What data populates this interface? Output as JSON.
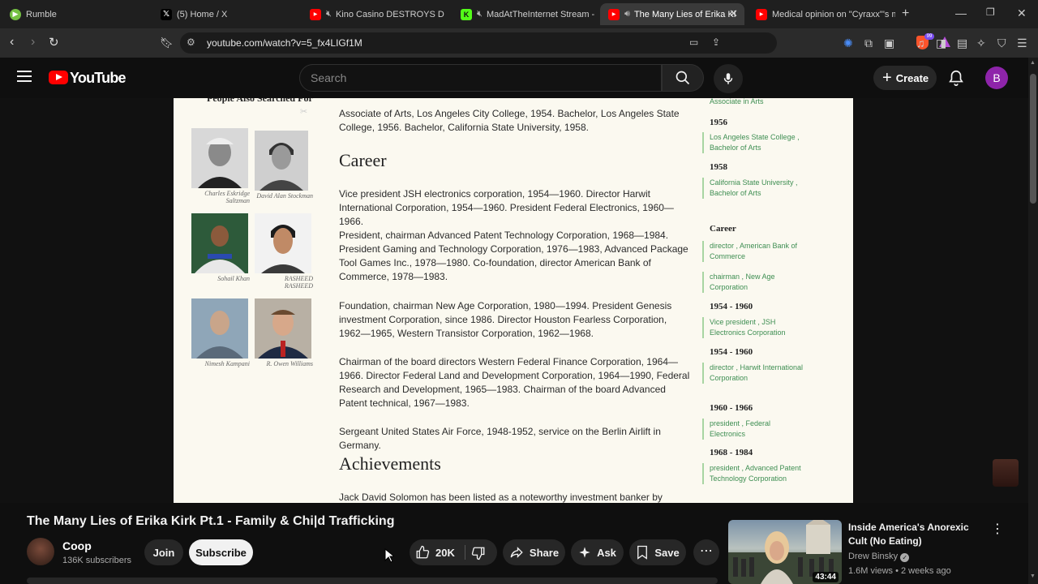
{
  "browser": {
    "tabs": [
      {
        "label": "Rumble",
        "favicon_color": "#74c043",
        "favicon": "▶",
        "muted": false,
        "active": false
      },
      {
        "label": "(5) Home / X",
        "favicon_color": "#000000",
        "favicon": "X",
        "muted": false,
        "active": false
      },
      {
        "label": "Kino Casino DESTROYS DSP",
        "favicon_color": "#ff0000",
        "favicon": "▶",
        "muted": true,
        "active": false
      },
      {
        "label": "MadAtTheInternet Stream -",
        "favicon_color": "#53fc18",
        "favicon": "K",
        "muted": true,
        "active": false
      },
      {
        "label": "The Many Lies of Erika Ki",
        "favicon_color": "#ff0000",
        "favicon": "▶",
        "muted": false,
        "audio": true,
        "active": true
      },
      {
        "label": "Medical opinion on \"Cyraxx\"'s m",
        "favicon_color": "#ff0000",
        "favicon": "▶",
        "muted": false,
        "active": false
      }
    ],
    "url": "youtube.com/watch?v=5_fx4LIGf1M"
  },
  "youtube": {
    "logo_text": "YouTube",
    "search_placeholder": "Search",
    "create_label": "Create",
    "avatar_letter": "B"
  },
  "video_frame": {
    "sidebar_title": "People Also Searched For",
    "people": [
      {
        "name": "Charles Eskridge Saltzman"
      },
      {
        "name": "David Alan Stockman"
      },
      {
        "name": "Sohail Khan"
      },
      {
        "name": "RASHEED RASHEED"
      },
      {
        "name": "Nimesh Kampani"
      },
      {
        "name": "R. Owen Williams"
      }
    ],
    "education_text": "Associate of Arts, Los Angeles City College, 1954. Bachelor, Los Angeles State College, 1956. Bachelor, California State University, 1958.",
    "career_heading": "Career",
    "career_paragraphs": [
      "Vice president JSH electronics corporation, 1954—1960. Director Harwit International Corporation, 1954—1960. President Federal Electronics, 1960—1966.",
      "President, chairman Advanced Patent Technology Corporation, 1968—1984. President Gaming and Technology Corporation, 1976—1983, Advanced Package Tool Games Inc., 1978—1980. Co-foundation, director American Bank of Commerce, 1978—1983.",
      "Foundation, chairman New Age Corporation, 1980—1994. President Genesis investment Corporation, since 1986. Director Houston Fearless Corporation, 1962—1965, Western Transistor Corporation, 1962—1968.",
      "Chairman of the board directors Western Federal Finance Corporation, 1964—1966. Director Federal Land and Development Corporation, 1964—1990, Federal Research and Development, 1965—1983. Chairman of the board Advanced Patent technical, 1967—1983.",
      "Sergeant United States Air Force, 1948-1952, service on the Berlin Airlift in Germany."
    ],
    "achievements_heading": "Achievements",
    "achievements_text": "Jack David Solomon has been listed as a noteworthy investment banker by Marquis",
    "timeline": {
      "top_item": "Associate in Arts",
      "edu": [
        {
          "year": "1956",
          "detail": "Los Angeles State College , Bachelor of Arts"
        },
        {
          "year": "1958",
          "detail": "California State University , Bachelor of Arts"
        }
      ],
      "career_label": "Career",
      "career_undated": [
        "director , American Bank of Commerce",
        "chairman , New Age Corporation"
      ],
      "career": [
        {
          "year": "1954 - 1960",
          "detail": "Vice president , JSH Electronics Corporation"
        },
        {
          "year": "1954 - 1960",
          "detail": "director , Harwit International Corporation"
        },
        {
          "year": "1960 - 1966",
          "detail": "president , Federal Electronics"
        },
        {
          "year": "1968 - 1984",
          "detail": "president , Advanced Patent Technology Corporation"
        }
      ]
    }
  },
  "video": {
    "title": "The Many Lies of Erika Kirk Pt.1 - Family & Chi|d Trafficking",
    "channel": "Coop",
    "subscribers": "136K subscribers",
    "join_label": "Join",
    "subscribe_label": "Subscribe",
    "likes": "20K",
    "share_label": "Share",
    "ask_label": "Ask",
    "save_label": "Save"
  },
  "recommended": {
    "title": "Inside America's Anorexic Cult (No Eating)",
    "channel": "Drew Binsky",
    "meta": "1.6M views • 2 weeks ago",
    "duration": "43:44"
  }
}
